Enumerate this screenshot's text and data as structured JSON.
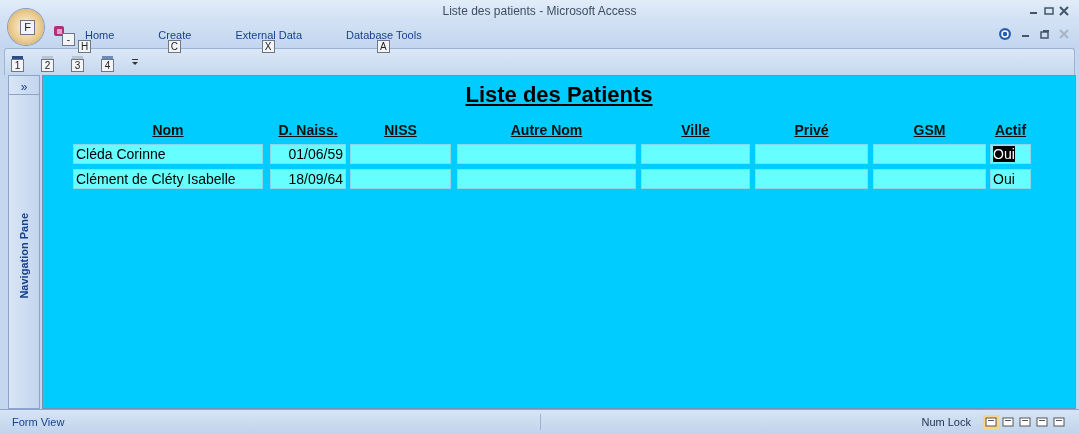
{
  "window": {
    "title": "Liste des patients - Microsoft Access"
  },
  "office_button": {
    "keytip": "F"
  },
  "ribbon_tabs": [
    {
      "label": "Home",
      "keytip": "H",
      "selected": false
    },
    {
      "label": "Create",
      "keytip": "C",
      "selected": false
    },
    {
      "label": "External Data",
      "keytip": "X",
      "selected": false
    },
    {
      "label": "Database Tools",
      "keytip": "A",
      "selected": false
    }
  ],
  "app_icon_keytip": "-",
  "quick_access_keytips": [
    "1",
    "2",
    "3",
    "4"
  ],
  "navigation_pane": {
    "label": "Navigation Pane",
    "toggle": "»"
  },
  "form": {
    "title": "Liste des Patients",
    "columns": [
      "Nom",
      "D. Naiss.",
      "NISS",
      "Autre Nom",
      "Ville",
      "Privé",
      "GSM",
      "Actif"
    ],
    "rows": [
      {
        "nom": "Cléda Corinne",
        "naissance": "01/06/59",
        "actif": "Oui",
        "actif_selected": true
      },
      {
        "nom": "Clément de Cléty Isabelle",
        "naissance": "18/09/64",
        "actif": "Oui",
        "actif_selected": false
      }
    ]
  },
  "status_bar": {
    "view": "Form View",
    "indicator": "Num Lock"
  }
}
